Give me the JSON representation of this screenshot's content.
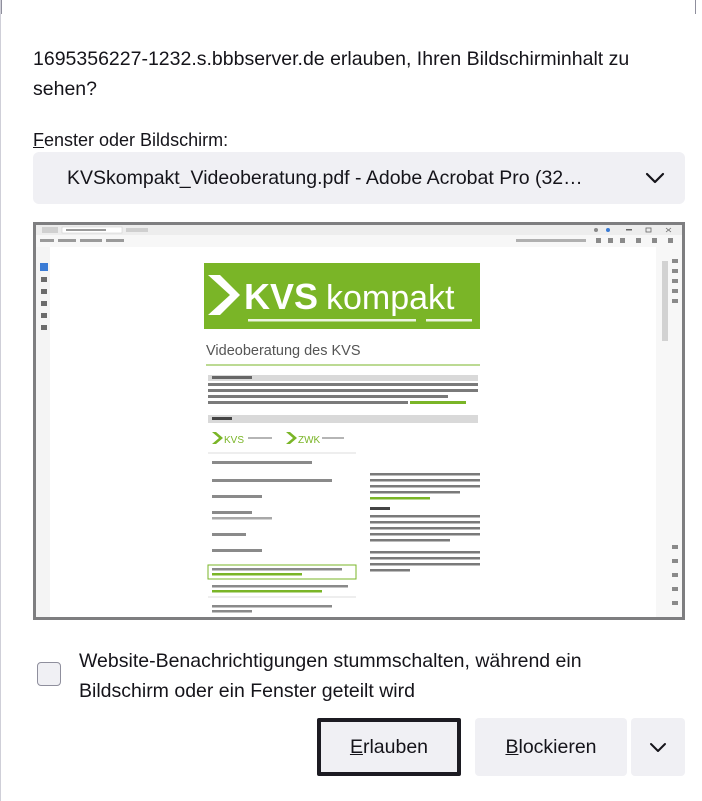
{
  "dialog": {
    "message": "1695356227-1232.s.bbbserver.de erlauben, Ihren Bildschirminhalt zu sehen?",
    "source_label_accesskey": "F",
    "source_label_rest": "enster oder Bildschirm:",
    "source_selected": "KVSkompakt_Videoberatung.pdf - Adobe Acrobat Pro (32…",
    "mute_notifications_label": "Website-Benachrichtigungen stummschalten, während ein Bildschirm oder ein Fenster geteilt wird",
    "mute_notifications_checked": false,
    "allow_accesskey": "E",
    "allow_rest": "rlauben",
    "block_accesskey": "B",
    "block_rest": "lockieren",
    "more_icon": "chevron-down-icon"
  },
  "preview": {
    "banner_brand_bold": "KVS",
    "banner_brand_light": "kompakt",
    "document_heading": "Videoberatung des KVS",
    "logo_kvs": "KVS",
    "logo_zwk": "ZWK"
  },
  "colors": {
    "brand_green": "#7ab527",
    "button_bg": "#f0f0f4",
    "focus_border": "#1c1b22",
    "preview_border": "#7e7e80"
  }
}
